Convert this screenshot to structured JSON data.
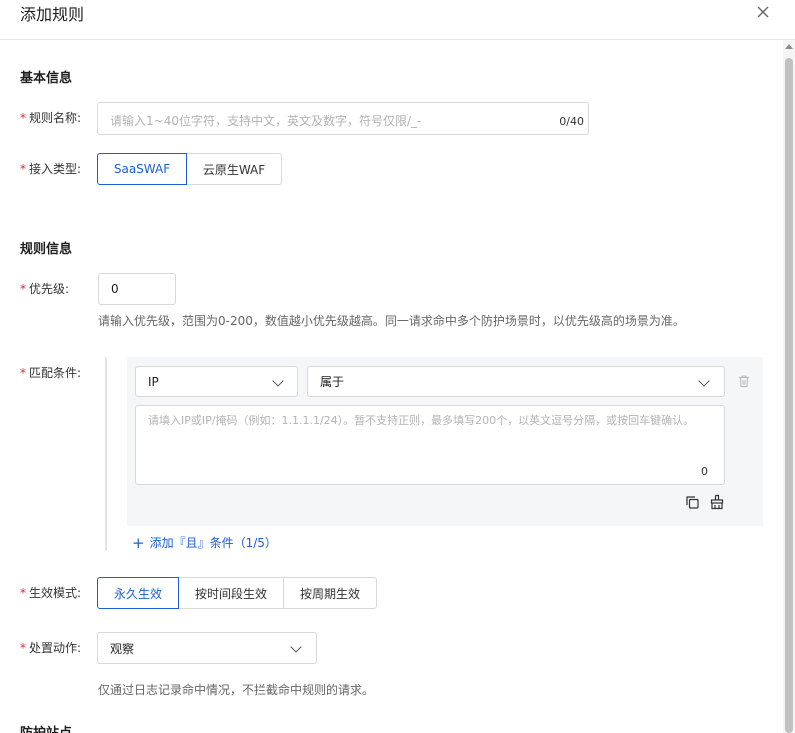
{
  "dialog": {
    "title": "添加规则"
  },
  "basic_info": {
    "section_title": "基本信息",
    "rule_name": {
      "label": "规则名称:",
      "placeholder": "请输入1~40位字符，支持中文，英文及数字，符号仅限/_-",
      "count": "0/40"
    },
    "access_type": {
      "label": "接入类型:",
      "options": [
        "SaaSWAF",
        "云原生WAF"
      ],
      "selected": "SaaSWAF"
    }
  },
  "rule_info": {
    "section_title": "规则信息",
    "priority": {
      "label": "优先级:",
      "value": "0",
      "help": "请输入优先级，范围为0-200，数值越小优先级越高。同一请求命中多个防护场景时，以优先级高的场景为准。"
    },
    "match_condition": {
      "label": "匹配条件:",
      "field": "IP",
      "operator": "属于",
      "textarea_placeholder": "请填入IP或IP/掩码（例如：1.1.1.1/24）。暂不支持正则，最多填写200个，以英文逗号分隔，或按回车键确认。",
      "textarea_count": "0",
      "add_condition_label": "添加『且』条件（1/5）"
    },
    "effect_mode": {
      "label": "生效模式:",
      "options": [
        "永久生效",
        "按时间段生效",
        "按周期生效"
      ],
      "selected": "永久生效"
    },
    "action": {
      "label": "处置动作:",
      "value": "观察",
      "help": "仅通过日志记录命中情况，不拦截命中规则的请求。"
    }
  },
  "next_section": {
    "section_title": "防护站点"
  },
  "colors": {
    "primary": "#1a5fd6",
    "required": "#e6253a"
  }
}
